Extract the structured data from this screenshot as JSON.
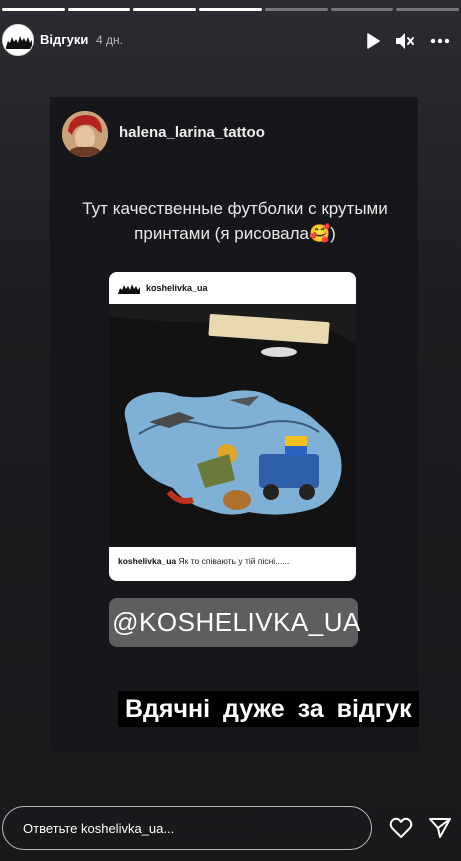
{
  "story": {
    "segments": [
      1,
      1,
      1,
      1,
      0,
      0,
      0
    ],
    "account_name": "Відгуки",
    "time_ago": "4 дн.",
    "play_icon": "play-icon",
    "mute_icon": "muted-speaker-icon",
    "more_icon": "more-dots-icon"
  },
  "post": {
    "username": "halena_larina_tattoo",
    "text": "Тут качественные футболки с крутыми принтами (я рисовала🥰)",
    "embed": {
      "account": "koshelivka_ua",
      "caption_user": "koshelivka_ua",
      "caption_text": " Як то співають у тій пісні......"
    },
    "mention": "@KOSHELIVKA_UA",
    "mention_icon": "threads-icon",
    "overlay_text": "Вдячні дуже за відгук"
  },
  "footer": {
    "reply_placeholder": "Ответьте koshelivka_ua...",
    "like_icon": "heart-icon",
    "share_icon": "send-icon"
  },
  "colors": {
    "background": "#1a1c1f",
    "card": "#16171a",
    "mention_bg": "#5e5e5e"
  }
}
